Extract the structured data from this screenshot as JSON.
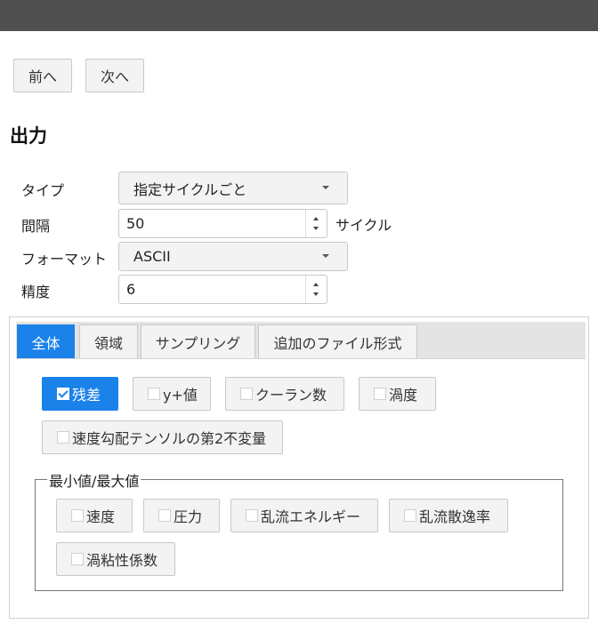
{
  "nav": {
    "prev_label": "前へ",
    "next_label": "次へ"
  },
  "page_title": "出力",
  "form": {
    "type_label": "タイプ",
    "type_value": "指定サイクルごと",
    "interval_label": "間隔",
    "interval_value": "50",
    "interval_unit": "サイクル",
    "format_label": "フォーマット",
    "format_value": "ASCII",
    "precision_label": "精度",
    "precision_value": "6"
  },
  "tabs": [
    {
      "label": "全体",
      "active": true
    },
    {
      "label": "領域",
      "active": false
    },
    {
      "label": "サンプリング",
      "active": false
    },
    {
      "label": "追加のファイル形式",
      "active": false
    }
  ],
  "general_checks": [
    {
      "label": "残差",
      "checked": true
    },
    {
      "label": "y+値",
      "checked": false
    },
    {
      "label": "クーラン数",
      "checked": false
    },
    {
      "label": "渦度",
      "checked": false
    },
    {
      "label": "速度勾配テンソルの第2不変量",
      "checked": false
    }
  ],
  "minmax": {
    "legend": "最小値/最大値",
    "checks": [
      {
        "label": "速度",
        "checked": false
      },
      {
        "label": "圧力",
        "checked": false
      },
      {
        "label": "乱流エネルギー",
        "checked": false
      },
      {
        "label": "乱流散逸率",
        "checked": false
      },
      {
        "label": "渦粘性係数",
        "checked": false
      }
    ]
  },
  "colors": {
    "accent": "#1a82e8",
    "topbar": "#505050"
  }
}
